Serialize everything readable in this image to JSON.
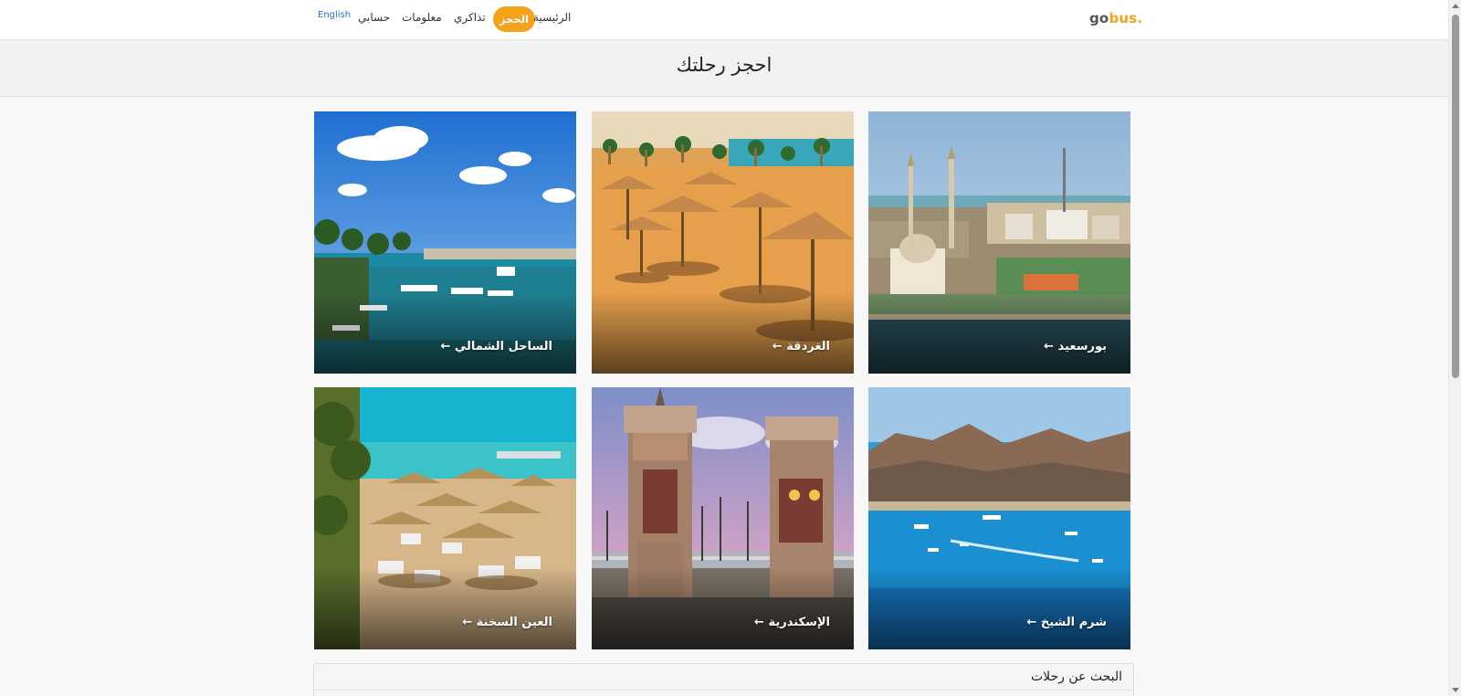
{
  "brand": {
    "part1": "go",
    "part2": "bus",
    "dot": "."
  },
  "nav": {
    "home": "الرئيسية",
    "booking": "الحجز",
    "tickets": "تذاكري",
    "info": "معلومات",
    "account": "حسابي",
    "language": "English"
  },
  "page": {
    "title": "احجز رحلتك"
  },
  "destinations": [
    {
      "label": "بورسعيد ←",
      "icon": "arrow-left-icon"
    },
    {
      "label": "الغردقة ←",
      "icon": "arrow-left-icon"
    },
    {
      "label": "الساحل الشمالي ←",
      "icon": "arrow-left-icon"
    },
    {
      "label": "شرم الشيخ ←",
      "icon": "arrow-left-icon"
    },
    {
      "label": "الإسكندرية ←",
      "icon": "arrow-left-icon"
    },
    {
      "label": "العين السخنة ←",
      "icon": "arrow-left-icon"
    }
  ],
  "search": {
    "header": "البحث عن رحلات"
  },
  "colors": {
    "accent": "#f5a21b",
    "link": "#2a6fd6"
  }
}
